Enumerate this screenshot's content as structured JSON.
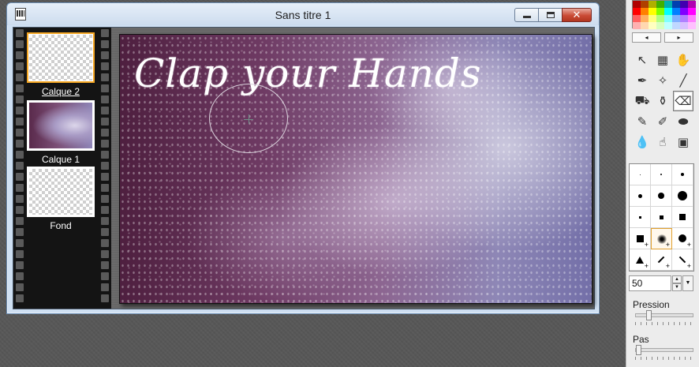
{
  "window": {
    "title": "Sans titre 1",
    "min_glyph": "",
    "max_glyph": "",
    "close_glyph": "✕"
  },
  "layers": [
    {
      "name": "Calque 2",
      "selected": true,
      "thumb": "transparent"
    },
    {
      "name": "Calque 1",
      "selected": false,
      "thumb": "image"
    },
    {
      "name": "Fond",
      "selected": false,
      "thumb": "transparent"
    }
  ],
  "canvas": {
    "text": "Clap your Hands"
  },
  "palette": {
    "colors": [
      "#b00000",
      "#b04000",
      "#b0b000",
      "#40b000",
      "#00b0b0",
      "#0040b0",
      "#4000b0",
      "#b000b0",
      "#ff0000",
      "#ff8000",
      "#ffff00",
      "#80ff00",
      "#00ffff",
      "#0080ff",
      "#8000ff",
      "#ff00ff",
      "#ff6060",
      "#ffb060",
      "#ffff80",
      "#b0ff80",
      "#80ffff",
      "#80b0ff",
      "#b080ff",
      "#ff80ff",
      "#ffb0b0",
      "#ffd8b0",
      "#ffffc0",
      "#d8ffc0",
      "#c0ffff",
      "#c0d8ff",
      "#d8c0ff",
      "#ffc0ff"
    ],
    "prev": "◂",
    "next": "▸"
  },
  "tools": [
    {
      "name": "select-arrow-icon",
      "glyph": "↖"
    },
    {
      "name": "rect-select-icon",
      "glyph": "▦"
    },
    {
      "name": "hand-icon",
      "glyph": "✋"
    },
    {
      "name": "eyedropper-icon",
      "glyph": "✒"
    },
    {
      "name": "magic-wand-icon",
      "glyph": "✧"
    },
    {
      "name": "line-icon",
      "glyph": "╱"
    },
    {
      "name": "paint-bucket-icon",
      "glyph": "⛟"
    },
    {
      "name": "spray-icon",
      "glyph": "⚱"
    },
    {
      "name": "eraser-icon",
      "glyph": "⌫"
    },
    {
      "name": "brush-icon",
      "glyph": "✎"
    },
    {
      "name": "brush-plus-icon",
      "glyph": "✐"
    },
    {
      "name": "stamp-icon",
      "glyph": "⬬"
    },
    {
      "name": "drop-icon",
      "glyph": "💧"
    },
    {
      "name": "smudge-icon",
      "glyph": "☝"
    },
    {
      "name": "portrait-icon",
      "glyph": "▣"
    }
  ],
  "active_tool_index": 8,
  "brushes": [
    {
      "shape": "dot",
      "size": 1
    },
    {
      "shape": "dot",
      "size": 2
    },
    {
      "shape": "dot",
      "size": 4
    },
    {
      "shape": "dot",
      "size": 5
    },
    {
      "shape": "dot",
      "size": 8
    },
    {
      "shape": "dot",
      "size": 12
    },
    {
      "shape": "sq",
      "size": 3
    },
    {
      "shape": "sq",
      "size": 5
    },
    {
      "shape": "sq",
      "size": 8
    },
    {
      "shape": "sq",
      "size": 9,
      "plus": true
    },
    {
      "shape": "soft",
      "size": 12,
      "plus": true,
      "selected": true
    },
    {
      "shape": "dot",
      "size": 10,
      "plus": true
    },
    {
      "shape": "tri",
      "size": 10,
      "plus": true
    },
    {
      "shape": "slash",
      "size": 8,
      "plus": true
    },
    {
      "shape": "bslash",
      "size": 8,
      "plus": true
    }
  ],
  "size": {
    "value": "50",
    "up": "▲",
    "down": "▼",
    "dropdown": "▼"
  },
  "pression": {
    "label": "Pression",
    "value": 0.2
  },
  "pas": {
    "label": "Pas",
    "value": 0.0
  }
}
